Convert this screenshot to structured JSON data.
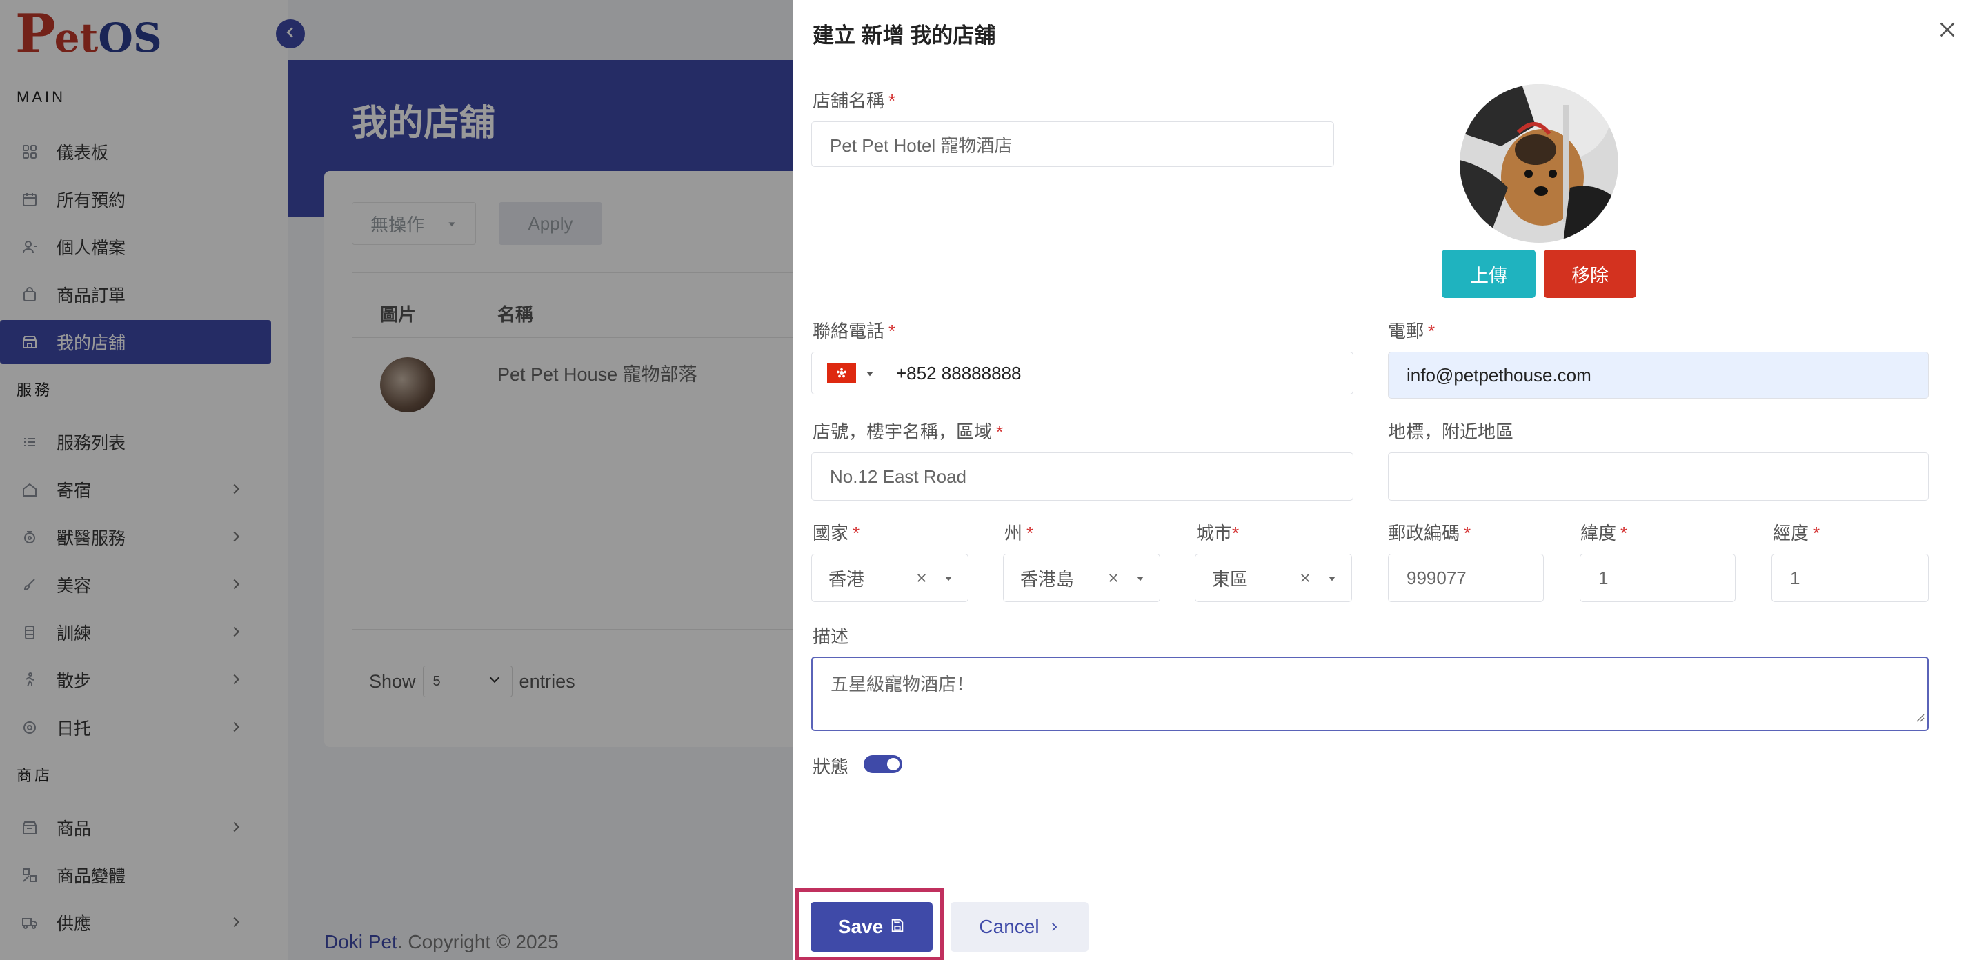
{
  "app": {
    "logo_p": "P",
    "logo_et": "et",
    "logo_os": "OS"
  },
  "sidebar": {
    "section_main": "MAIN",
    "section_services": "服務",
    "section_shop": "商店",
    "items": [
      {
        "label": "儀表板",
        "icon": "dashboard-icon"
      },
      {
        "label": "所有預約",
        "icon": "calendar-icon"
      },
      {
        "label": "個人檔案",
        "icon": "user-icon"
      },
      {
        "label": "商品訂單",
        "icon": "bag-icon"
      },
      {
        "label": "我的店舖",
        "icon": "shop-icon",
        "active": true
      },
      {
        "label": "服務列表",
        "icon": "list-icon"
      },
      {
        "label": "寄宿",
        "icon": "house-icon"
      },
      {
        "label": "獸醫服務",
        "icon": "stethoscope-icon"
      },
      {
        "label": "美容",
        "icon": "brush-icon"
      },
      {
        "label": "訓練",
        "icon": "training-icon"
      },
      {
        "label": "散步",
        "icon": "walk-icon"
      },
      {
        "label": "日托",
        "icon": "daycare-icon"
      },
      {
        "label": "商品",
        "icon": "store-icon"
      },
      {
        "label": "商品變體",
        "icon": "variant-icon"
      },
      {
        "label": "供應",
        "icon": "truck-icon"
      }
    ]
  },
  "page": {
    "title": "我的店舖",
    "bulk_action": "無操作",
    "apply": "Apply",
    "columns": [
      "圖片",
      "名稱"
    ],
    "rows": [
      {
        "name": "Pet Pet House 寵物部落"
      }
    ],
    "show": "Show",
    "entries_value": "5",
    "entries": "entries",
    "footer_brand": "Doki Pet",
    "footer_text": ". Copyright © 2025"
  },
  "drawer": {
    "title": "建立 新增 我的店舖",
    "shop_name_label": "店舖名稱",
    "shop_name_placeholder": "Pet Pet Hotel 寵物酒店",
    "upload": "上傳",
    "remove": "移除",
    "phone_label": "聯絡電話",
    "phone_value": "+852 88888888",
    "email_label": "電郵",
    "email_value": "info@petpethouse.com",
    "address_label": "店號，樓宇名稱，區域",
    "address_placeholder": "No.12 East Road",
    "landmark_label": "地標，附近地區",
    "landmark_value": "",
    "country_label": "國家",
    "country_value": "香港",
    "state_label": "州",
    "state_value": "香港島",
    "city_label": "城市",
    "city_value": "東區",
    "postal_label": "郵政編碼",
    "postal_value": "999077",
    "lat_label": "緯度",
    "lat_value": "1",
    "lng_label": "經度",
    "lng_value": "1",
    "desc_label": "描述",
    "desc_value": "五星級寵物酒店！",
    "status_label": "狀態",
    "status_on": true,
    "save": "Save",
    "cancel": "Cancel"
  },
  "colors": {
    "primary": "#3f4aa8",
    "upload": "#1fb3bf",
    "remove": "#d3321f",
    "highlight": "#c0305e",
    "required": "#d32f2f"
  }
}
